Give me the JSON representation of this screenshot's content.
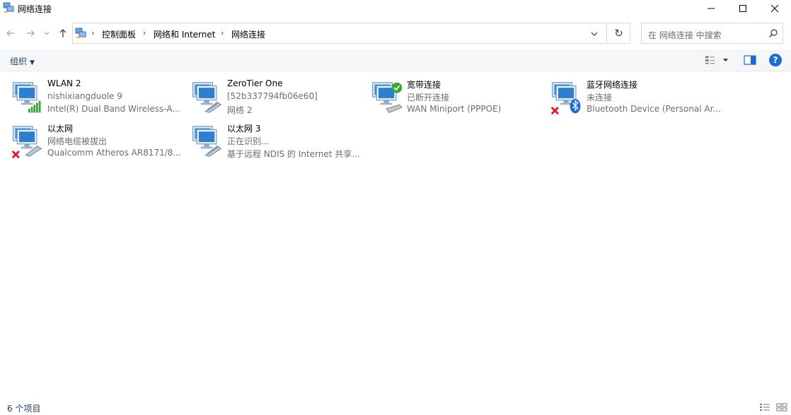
{
  "window": {
    "title": "网络连接"
  },
  "address": {
    "crumbs": [
      "控制面板",
      "网络和 Internet",
      "网络连接"
    ]
  },
  "search": {
    "placeholder": "在 网络连接 中搜索"
  },
  "toolbar": {
    "organize_label": "组织",
    "help_label": "?"
  },
  "connections": [
    {
      "name": "WLAN 2",
      "status": "nishixiangduole 9",
      "device": "Intel(R) Dual Band Wireless-A...",
      "icon": "wifi-adapter-icon",
      "badge": "signal-bars-icon"
    },
    {
      "name": "ZeroTier One",
      "status": "[52b337794fb06e60]",
      "device": "网络 2",
      "icon": "ethernet-adapter-icon",
      "badge": "network-cable-icon"
    },
    {
      "name": "宽带连接",
      "status": "已断开连接",
      "device": "WAN Miniport (PPPOE)",
      "icon": "broadband-icon",
      "badge": "check-icon"
    },
    {
      "name": "蓝牙网络连接",
      "status": "未连接",
      "device": "Bluetooth Device (Personal Ar...",
      "icon": "bluetooth-adapter-icon",
      "badge": "bluetooth-icon"
    },
    {
      "name": "以太网",
      "status": "网络电缆被拔出",
      "device": "Qualcomm Atheros AR8171/8...",
      "icon": "ethernet-adapter-icon",
      "badge": "disconnected-x-icon"
    },
    {
      "name": "以太网 3",
      "status": "正在识别...",
      "device": "基于远程 NDIS 的 Internet 共享...",
      "icon": "ethernet-adapter-icon",
      "badge": "network-cable-icon"
    }
  ],
  "statusbar": {
    "count": "6 个项目"
  },
  "colors": {
    "link_blue": "#1e395b",
    "help_blue": "#1e6bd6",
    "error_red": "#e81123",
    "ok_green": "#3aa63a"
  }
}
